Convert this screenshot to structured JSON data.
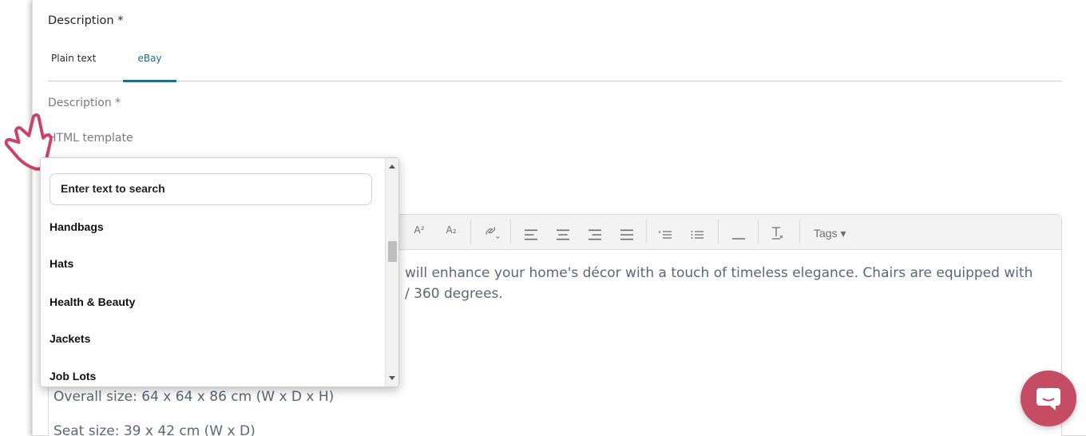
{
  "section": {
    "title": "Description *"
  },
  "tabs": [
    {
      "label": "Plain text",
      "active": false
    },
    {
      "label": "eBay",
      "active": true
    }
  ],
  "fields": {
    "description_label": "Description *",
    "template_label": "HTML template"
  },
  "dropdown": {
    "search_placeholder": "Enter text to search",
    "options": [
      "Handbags",
      "Hats",
      "Health & Beauty",
      "Jackets",
      "Job Lots"
    ]
  },
  "toolbar": {
    "superscript": "A²",
    "subscript": "A₂",
    "tags_label": "Tags ▾"
  },
  "editor": {
    "line1": "will enhance your home's décor with a touch of timeless elegance. Chairs are equipped with",
    "line2": "/ 360 degrees.",
    "line3": "Overall size: 64 x 64 x 86 cm (W x D x H)",
    "line4": "Seat size: 39 x 42 cm (W x D)"
  },
  "colors": {
    "accent": "#1f6d8a",
    "chat_button": "#c44c65",
    "cursor_outline": "#c9436a",
    "editor_text": "#5b6676"
  }
}
